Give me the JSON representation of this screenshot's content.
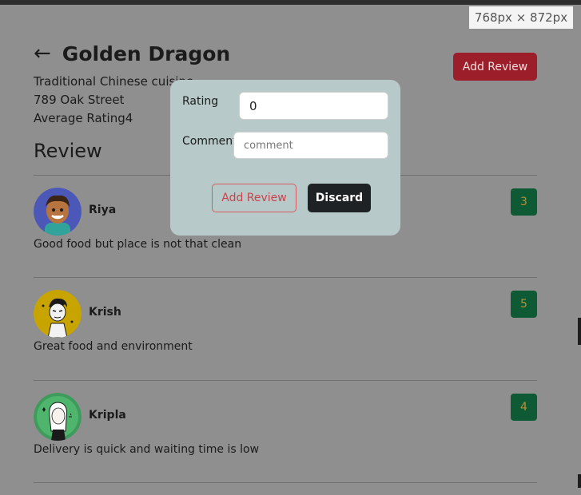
{
  "viewport_label": "768px × 872px",
  "restaurant": {
    "back_icon": "←",
    "name": "Golden Dragon",
    "cuisine": "Traditional Chinese cuisine",
    "address": "789 Oak Street",
    "average_rating_label": "Average Rating4"
  },
  "header": {
    "add_review_label": "Add Review"
  },
  "section_title": "Review",
  "reviews": [
    {
      "name": "Riya",
      "text": "Good food but place is not that clean",
      "rating": "3",
      "avatar": "boy-avatar"
    },
    {
      "name": "Krish",
      "text": "Great food and environment",
      "rating": "5",
      "avatar": "sketch-avatar"
    },
    {
      "name": "Kripla",
      "text": "Delivery is quick and waiting time is low",
      "rating": "4",
      "avatar": "girl-avatar"
    }
  ],
  "modal": {
    "rating_label": "Rating",
    "rating_value": "0",
    "comment_label": "Comment",
    "comment_placeholder": "comment",
    "add_button": "Add Review",
    "discard_button": "Discard"
  },
  "colors": {
    "overlay": "#8f8f8f",
    "accent_red": "#9b1e2a",
    "badge_green": "#0e5a34",
    "modal_bg": "#b8c9c9"
  }
}
